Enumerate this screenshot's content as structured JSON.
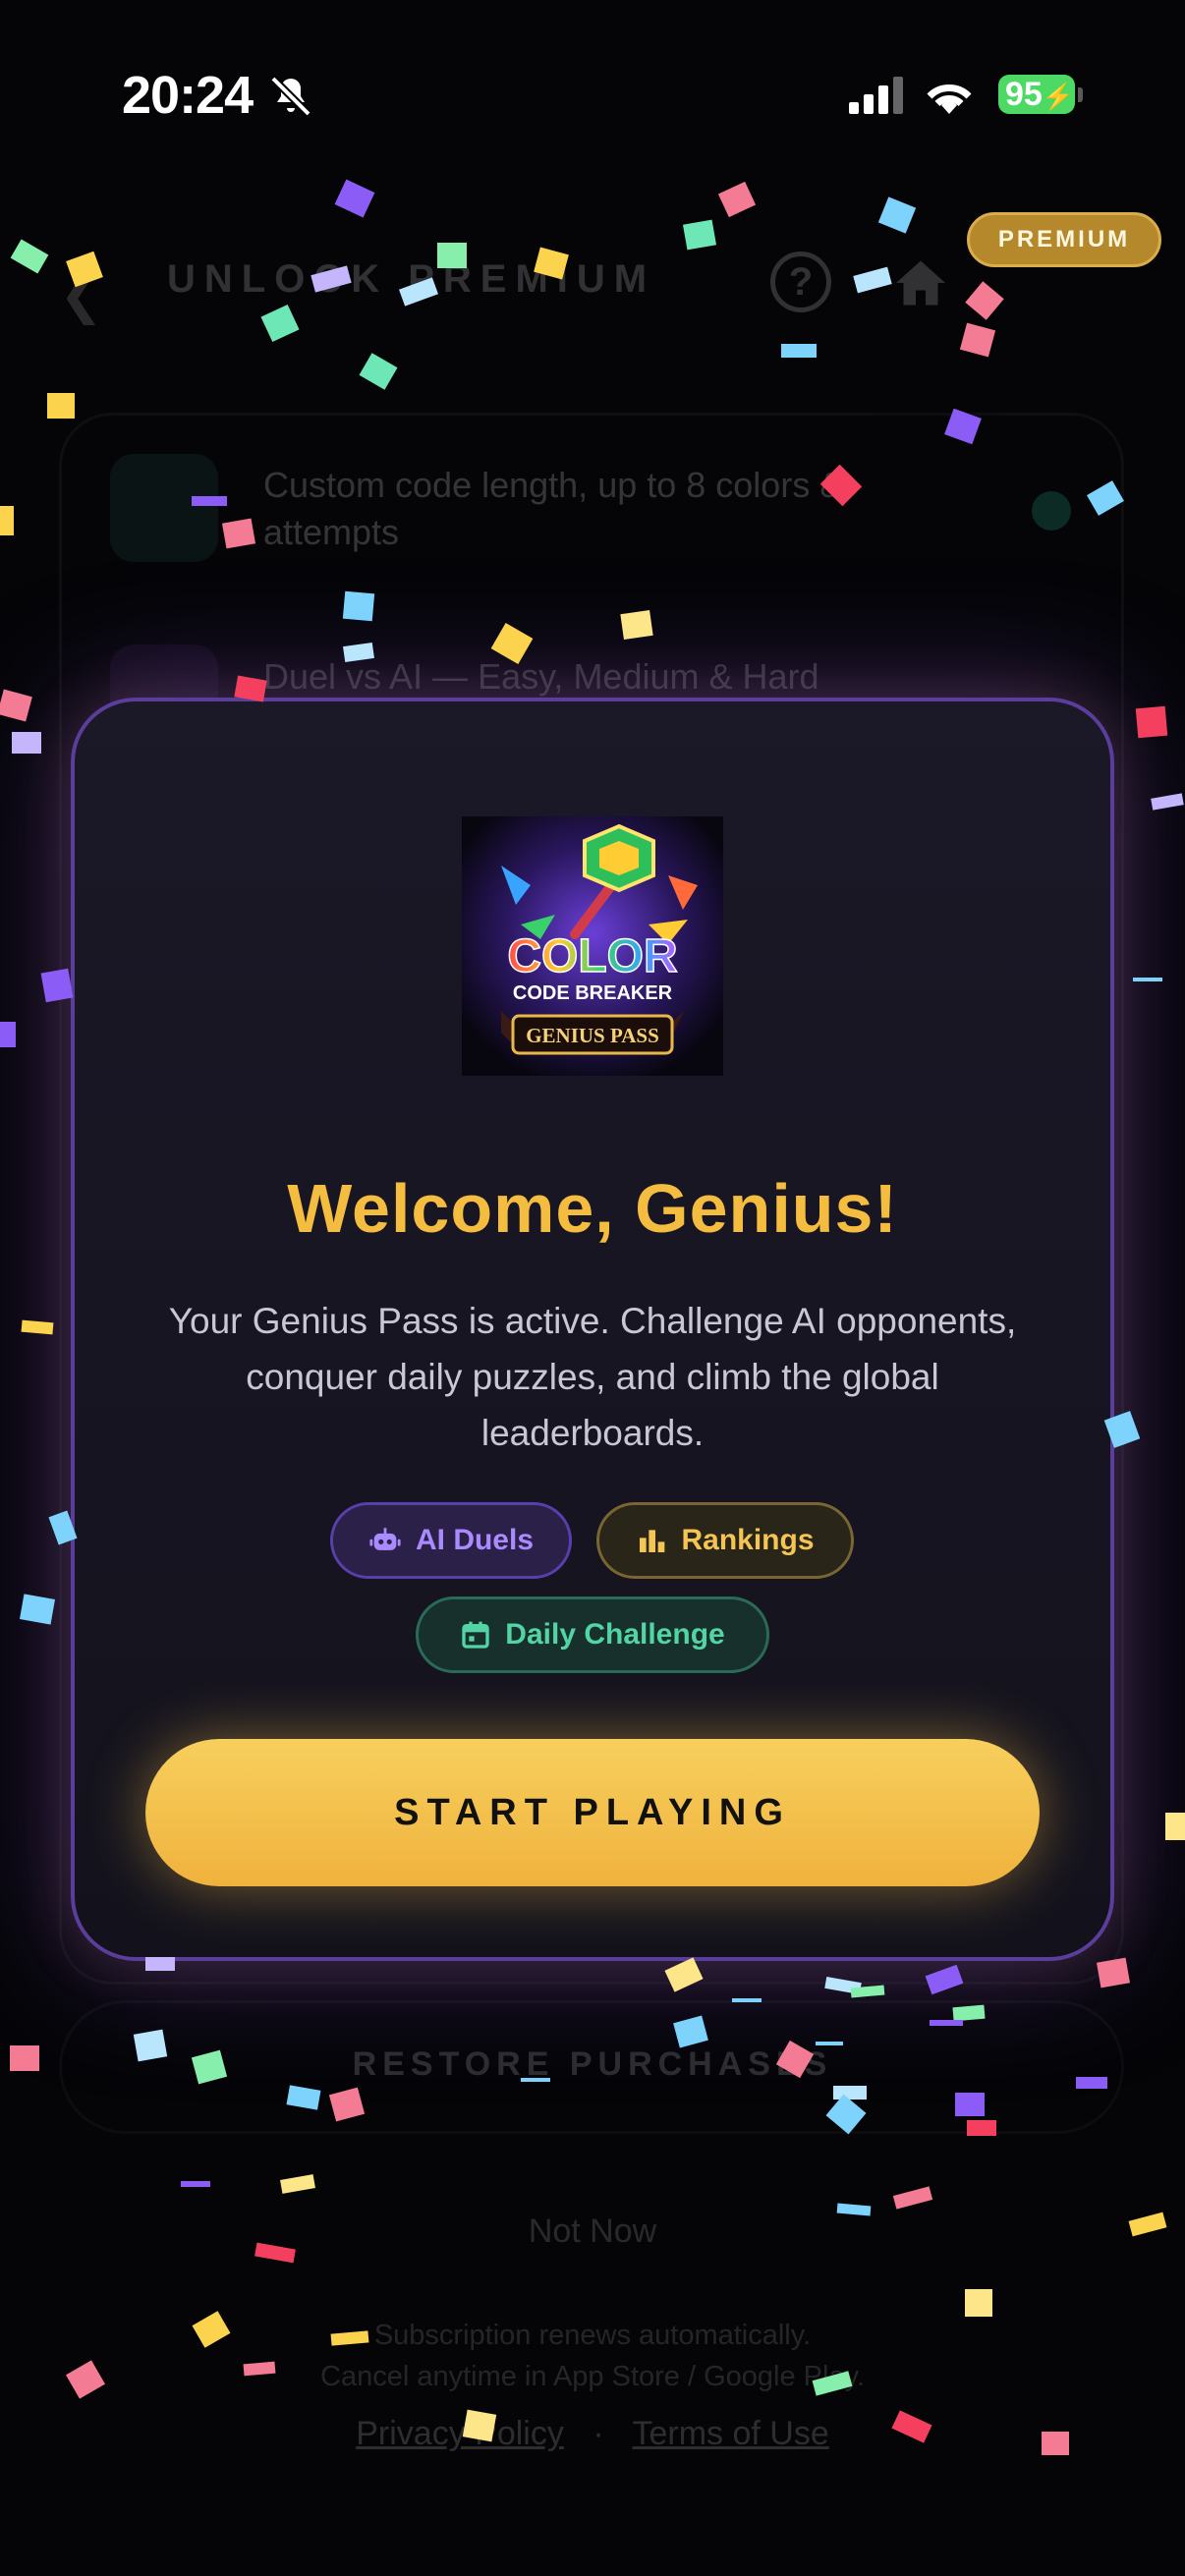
{
  "status_bar": {
    "time": "20:24",
    "battery": "95"
  },
  "background": {
    "title": "UNLOCK PREMIUM",
    "help_icon_glyph": "?",
    "features": [
      {
        "label": "Custom code length, up to 8 colors & attempts"
      },
      {
        "label": "Duel vs AI — Easy, Medium & Hard"
      }
    ],
    "restore_label": "RESTORE PURCHASES",
    "not_now_label": "Not Now",
    "legal_line1": "Subscription renews automatically.",
    "legal_line2": "Cancel anytime in App Store / Google Play.",
    "privacy_link": "Privacy Policy",
    "separator": "·",
    "terms_link": "Terms of Use"
  },
  "premium_badge": "PREMIUM",
  "modal": {
    "logo": {
      "line1": "COLOR",
      "line2": "CODE BREAKER",
      "line3": "GENIUS PASS"
    },
    "headline": "Welcome, Genius!",
    "body": "Your Genius Pass is active. Challenge AI opponents, conquer daily puzzles, and climb the global leaderboards.",
    "pills": [
      {
        "label": "AI Duels",
        "icon": "robot-icon"
      },
      {
        "label": "Rankings",
        "icon": "bar-chart-icon"
      },
      {
        "label": "Daily Challenge",
        "icon": "calendar-icon"
      }
    ],
    "cta_label": "START PLAYING"
  },
  "colors": {
    "accent_gold": "#f5bd3f",
    "accent_purple": "#a98bff",
    "accent_green": "#53d4a4",
    "modal_border": "#5b3d9b"
  }
}
